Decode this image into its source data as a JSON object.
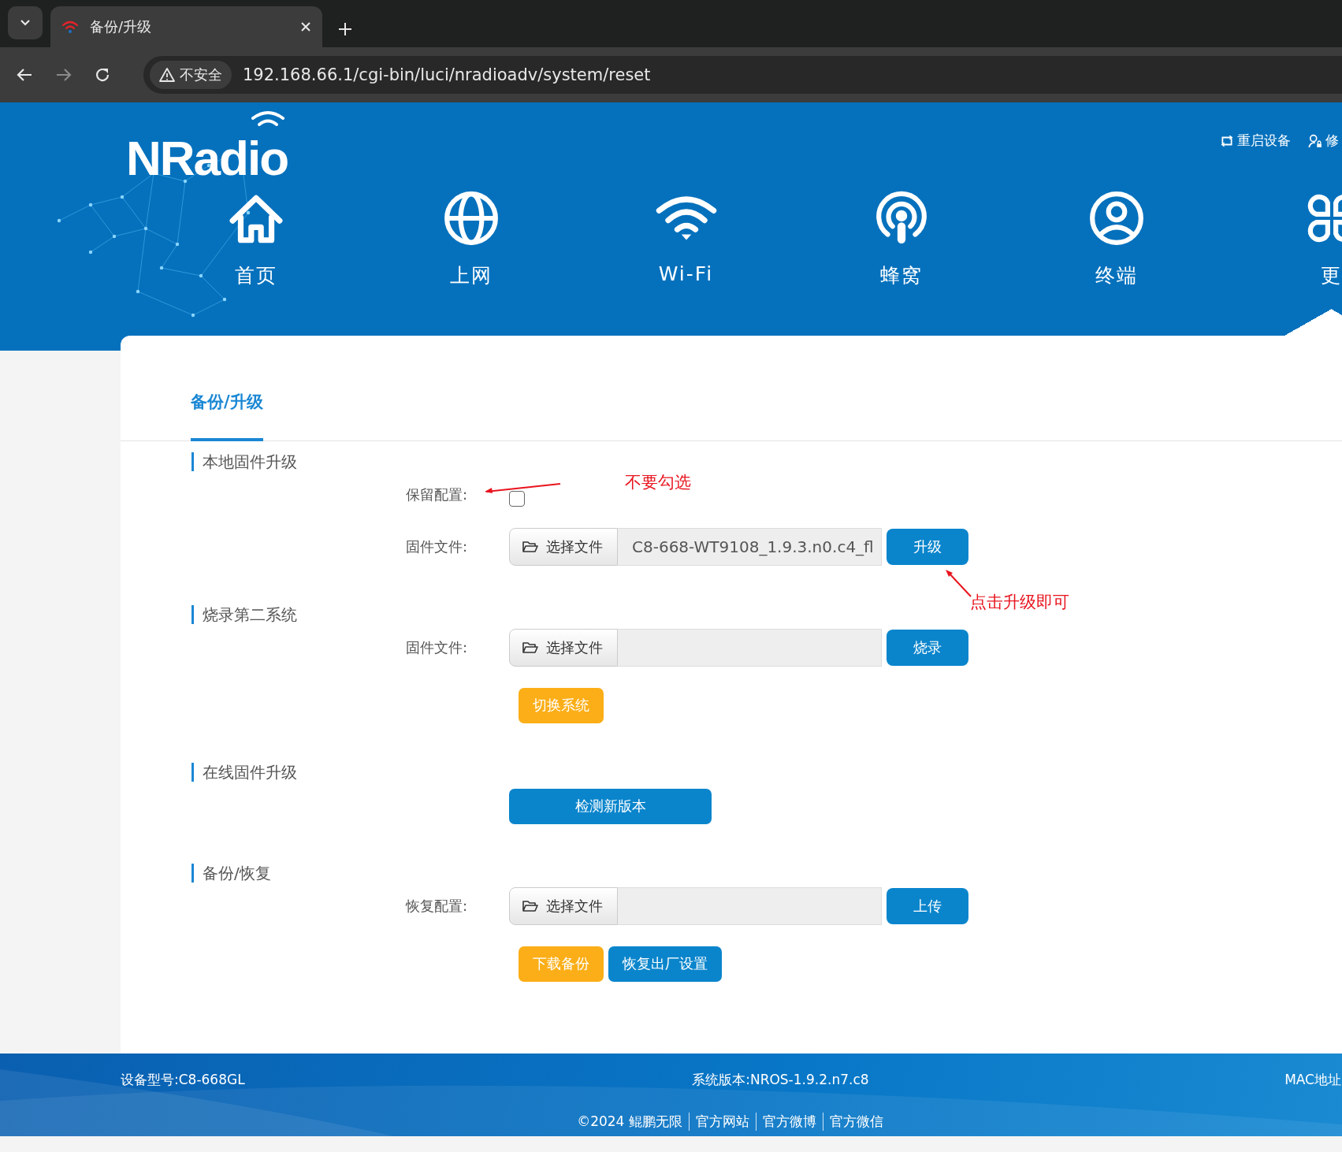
{
  "browser": {
    "tab_title": "备份/升级",
    "security_label": "不安全",
    "url": "192.168.66.1/cgi-bin/luci/nradioadv/system/reset"
  },
  "header": {
    "logo": "NRadio",
    "links": [
      {
        "label": "重启设备",
        "kind": "reboot"
      },
      {
        "label": "修",
        "kind": "user"
      }
    ],
    "nav": [
      {
        "label": "首页",
        "kind": "home",
        "selected": false
      },
      {
        "label": "上网",
        "kind": "globe",
        "selected": false
      },
      {
        "label": "Wi-Fi",
        "kind": "wifi",
        "selected": false
      },
      {
        "label": "蜂窝",
        "kind": "cellular",
        "selected": false
      },
      {
        "label": "终端",
        "kind": "user",
        "selected": false
      },
      {
        "label": "更",
        "kind": "more",
        "selected": true
      }
    ]
  },
  "page_tab": "备份/升级",
  "sections": [
    {
      "title": "本地固件升级",
      "rows": [
        {
          "kind": "checkbox",
          "label": "保留配置:",
          "checked": false
        },
        {
          "kind": "file",
          "label": "固件文件:",
          "browse": "选择文件",
          "value": "C8-668-WT9108_1.9.3.n0.c4_fl",
          "action": "升级"
        }
      ]
    },
    {
      "title": "烧录第二系统",
      "rows": [
        {
          "kind": "file",
          "label": "固件文件:",
          "browse": "选择文件",
          "action": "烧录"
        },
        {
          "kind": "buttons",
          "buttons": [
            {
              "label": "切换系统",
              "kind": "warning"
            }
          ]
        }
      ]
    },
    {
      "title": "在线固件升级",
      "rows": [
        {
          "kind": "buttons",
          "buttons": [
            {
              "label": "检测新版本",
              "kind": "wide"
            }
          ]
        }
      ]
    },
    {
      "title": "备份/恢复",
      "rows": [
        {
          "kind": "file",
          "label": "恢复配置:",
          "browse": "选择文件",
          "action": "上传"
        },
        {
          "kind": "buttons",
          "buttons": [
            {
              "label": "下载备份",
              "kind": "warning"
            },
            {
              "label": "恢复出厂设置",
              "kind": "primary"
            }
          ]
        }
      ]
    }
  ],
  "annotations": [
    {
      "text": "不要勾选"
    },
    {
      "text": "点击升级即可"
    }
  ],
  "footer": {
    "model": "设备型号:C8-668GL",
    "version": "系统版本:NROS-1.9.2.n7.c8",
    "mac": "MAC地址",
    "links": [
      "©2024 鲲鹏无限",
      "官方网站",
      "官方微博",
      "官方微信"
    ]
  }
}
